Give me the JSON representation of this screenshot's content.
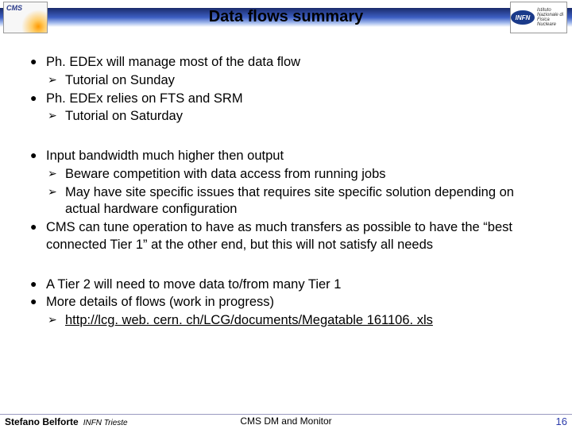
{
  "header": {
    "title": "Data flows summary",
    "logo_left": "CMS",
    "logo_right_acronym": "INFN",
    "logo_right_text": "Istituto Nazionale di Fisica Nucleare"
  },
  "blocks": [
    {
      "items": [
        {
          "text": "Ph. EDEx will manage most of the data flow",
          "sub": [
            {
              "text": "Tutorial on Sunday"
            }
          ]
        },
        {
          "text": "Ph. EDEx relies on FTS and SRM",
          "sub": [
            {
              "text": "Tutorial on Saturday"
            }
          ]
        }
      ]
    },
    {
      "items": [
        {
          "text": "Input bandwidth much higher then output",
          "sub": [
            {
              "text": "Beware competition with data access from running jobs"
            },
            {
              "text": "May have site specific issues that requires site specific solution depending on actual hardware configuration"
            }
          ]
        },
        {
          "text": "CMS can tune operation to have as much transfers as possible to have the “best connected Tier 1” at the other end, but this will not satisfy all needs"
        }
      ]
    },
    {
      "items": [
        {
          "text": "A Tier 2 will need to move data to/from many Tier 1"
        },
        {
          "text": "More details of flows (work in progress)",
          "sub": [
            {
              "text": "http://lcg. web. cern. ch/LCG/documents/Megatable 161106. xls",
              "link": true
            }
          ]
        }
      ]
    }
  ],
  "footer": {
    "author": "Stefano Belforte",
    "affiliation": "INFN Trieste",
    "center": "CMS DM and Monitor",
    "page": "16"
  }
}
